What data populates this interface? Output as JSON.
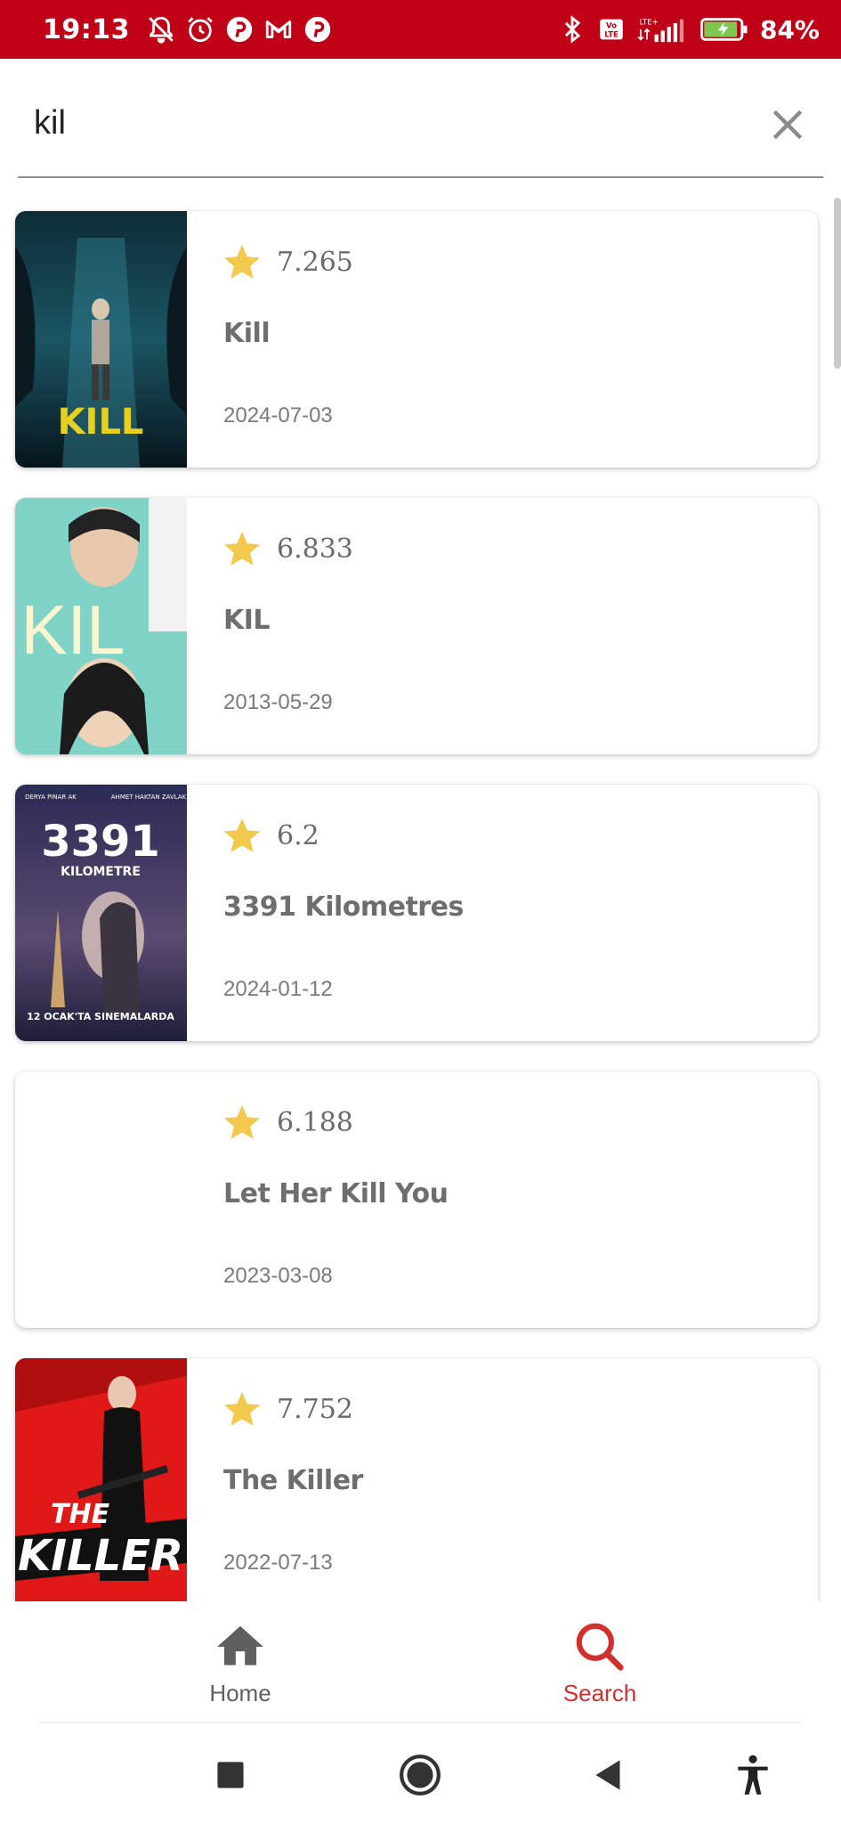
{
  "status_bar": {
    "time": "19:13",
    "battery_text": "84%",
    "left_icons": [
      "notifications-off-icon",
      "alarm-icon",
      "pinterest-icon",
      "gmail-icon",
      "pinterest-icon"
    ],
    "right_icons": [
      "bluetooth-icon",
      "volte-icon",
      "signal-icon",
      "battery-charging-icon"
    ],
    "color": "#c00016"
  },
  "search": {
    "query": "kil",
    "clear_icon": "close-icon"
  },
  "results": [
    {
      "rating": "7.265",
      "title": "Kill",
      "date": "2024-07-03",
      "poster": "poster-kill"
    },
    {
      "rating": "6.833",
      "title": "KIL",
      "date": "2013-05-29",
      "poster": "poster-kil"
    },
    {
      "rating": "6.2",
      "title": "3391 Kilometres",
      "date": "2024-01-12",
      "poster": "poster-3391"
    },
    {
      "rating": "6.188",
      "title": "Let Her Kill You",
      "date": "2023-03-08",
      "poster": ""
    },
    {
      "rating": "7.752",
      "title": "The Killer",
      "date": "2022-07-13",
      "poster": "poster-the-killer"
    }
  ],
  "posters": {
    "kill": {
      "text": "KILL"
    },
    "kil": {
      "text": "KIL"
    },
    "p3391": {
      "top_left": "DERYA PINAR AK",
      "top_right": "AHMET HAKTAN ZAVLAK",
      "number": "3391",
      "word": "KILOMETRE",
      "bottom": "12 OCAK'TA SINEMALARDA"
    },
    "killer": {
      "line1": "THE",
      "line2": "KILLER"
    }
  },
  "bottom_nav": {
    "home_label": "Home",
    "search_label": "Search",
    "active": "Search",
    "active_color": "#d32f2f",
    "inactive_color": "#5f5f5f"
  },
  "system_nav": [
    "recents-icon",
    "home-circle-icon",
    "back-icon",
    "accessibility-icon"
  ],
  "star_color": "#f2c94c"
}
